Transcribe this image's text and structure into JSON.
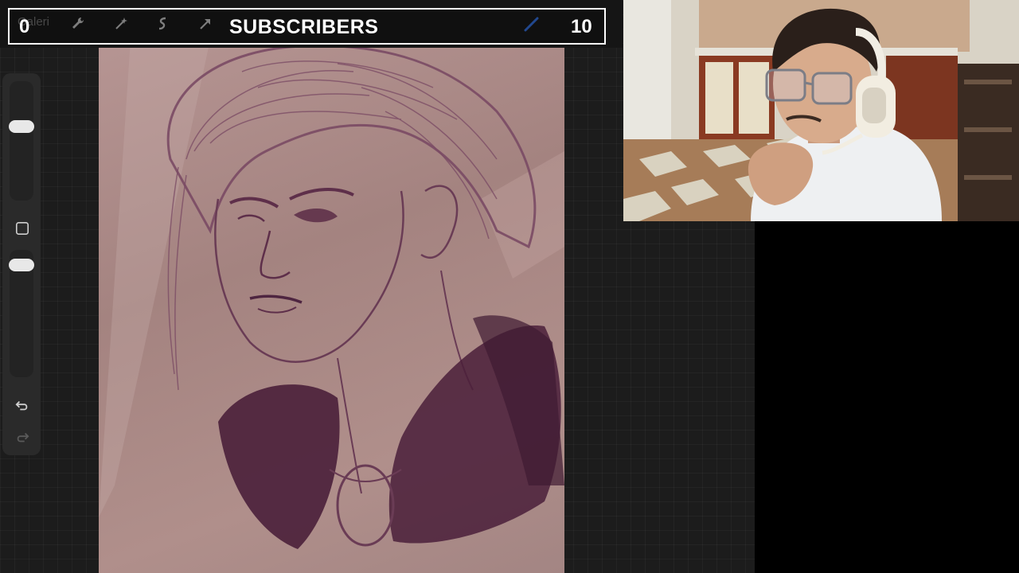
{
  "toolbar": {
    "gallery_label": "Galeri",
    "icons": [
      "wrench-icon",
      "magic-wand-icon",
      "selection-icon",
      "transform-arrow-icon",
      "brush-icon"
    ]
  },
  "subscribers": {
    "title": "SUBSCRIBERS",
    "left_count": "0",
    "right_count": "10"
  },
  "sidebar": {
    "icons": [
      "square-modifier-icon",
      "undo-icon",
      "redo-icon"
    ]
  },
  "colors": {
    "accent_brush": "#2f6ad8",
    "canvas_tone": "#a88683",
    "sketch_ink": "#6a3c55"
  }
}
